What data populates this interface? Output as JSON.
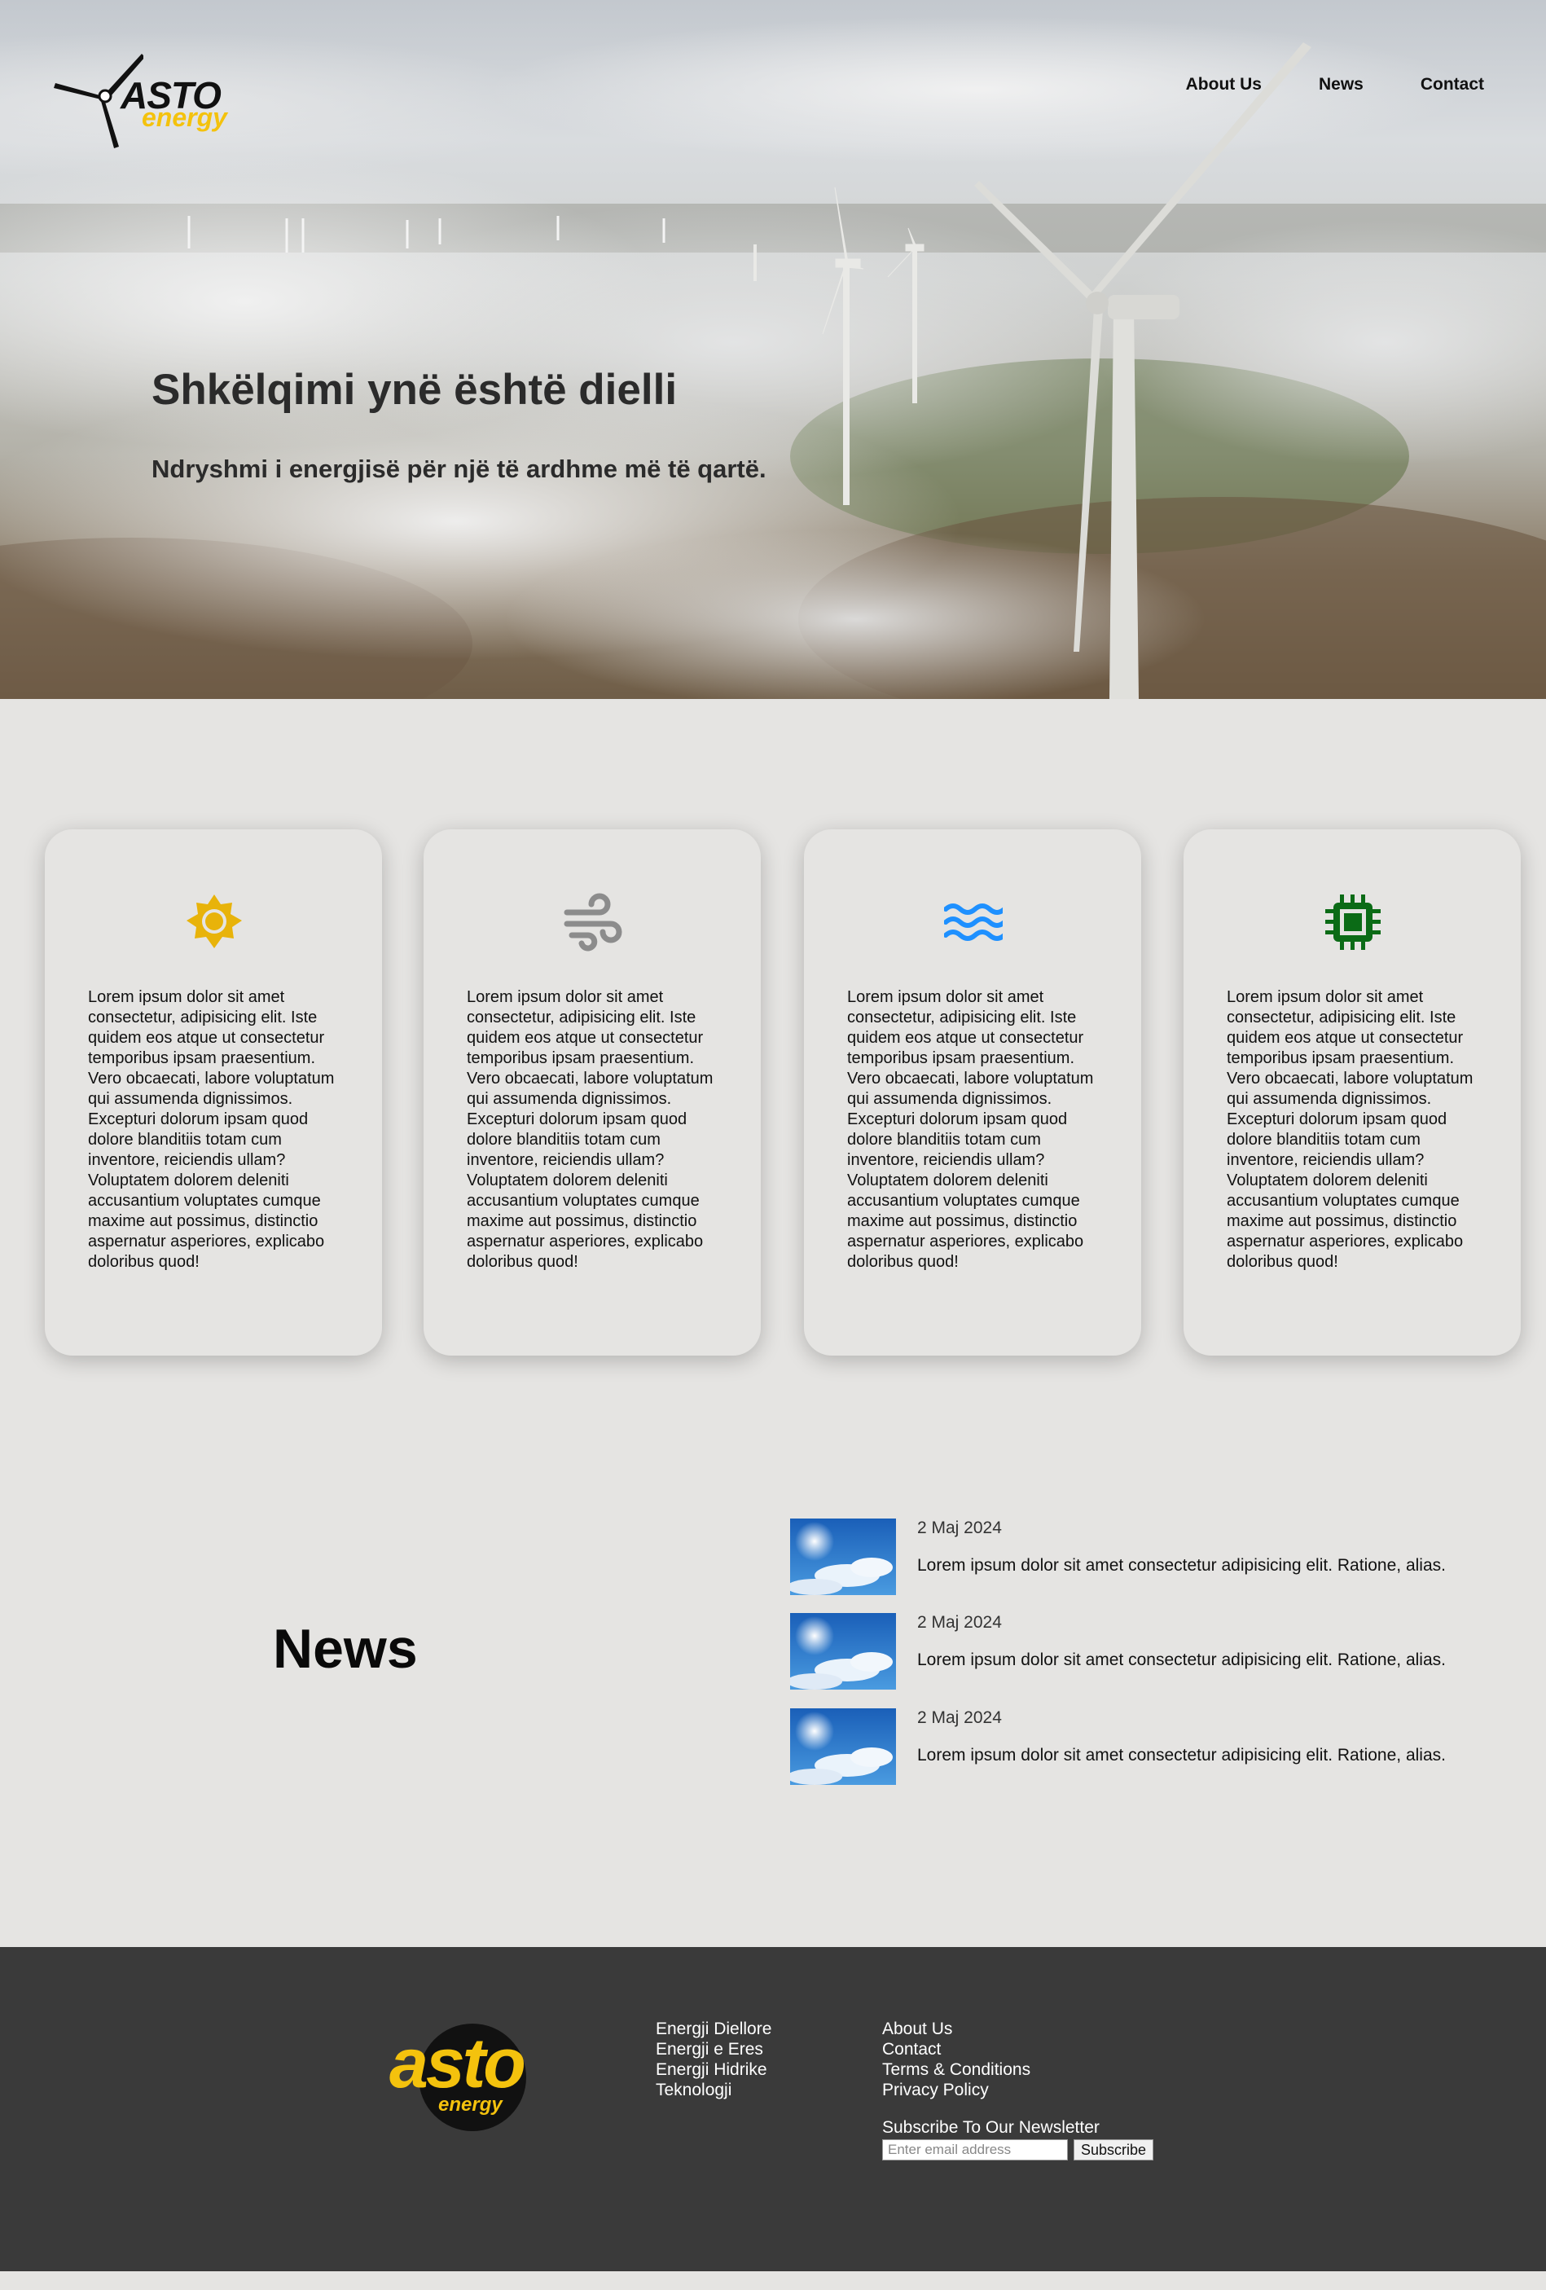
{
  "header": {
    "logo": {
      "word": "ASTO",
      "sub": "energy"
    },
    "nav": [
      {
        "label": "About Us"
      },
      {
        "label": "News"
      },
      {
        "label": "Contact"
      }
    ]
  },
  "hero": {
    "title": "Shkëlqimi ynë është dielli",
    "subtitle": "Ndryshmi i energjisë për një të ardhme më të qartë."
  },
  "cards": [
    {
      "icon": "sun-icon",
      "color": "#e8b30a",
      "text": "Lorem ipsum dolor sit amet consectetur, adipisicing elit. Iste quidem eos atque ut consectetur temporibus ipsam praesentium. Vero obcaecati, labore voluptatum qui assumenda dignissimos. Excepturi dolorum ipsam quod dolore blanditiis totam cum inventore, reiciendis ullam? Voluptatem dolorem deleniti accusantium voluptates cumque maxime aut possimus, distinctio aspernatur asperiores, explicabo doloribus quod!"
    },
    {
      "icon": "wind-icon",
      "color": "#8c8c8c",
      "text": "Lorem ipsum dolor sit amet consectetur, adipisicing elit. Iste quidem eos atque ut consectetur temporibus ipsam praesentium. Vero obcaecati, labore voluptatum qui assumenda dignissimos. Excepturi dolorum ipsam quod dolore blanditiis totam cum inventore, reiciendis ullam? Voluptatem dolorem deleniti accusantium voluptates cumque maxime aut possimus, distinctio aspernatur asperiores, explicabo doloribus quod!"
    },
    {
      "icon": "water-icon",
      "color": "#1e90ff",
      "text": "Lorem ipsum dolor sit amet consectetur, adipisicing elit. Iste quidem eos atque ut consectetur temporibus ipsam praesentium. Vero obcaecati, labore voluptatum qui assumenda dignissimos. Excepturi dolorum ipsam quod dolore blanditiis totam cum inventore, reiciendis ullam? Voluptatem dolorem deleniti accusantium voluptates cumque maxime aut possimus, distinctio aspernatur asperiores, explicabo doloribus quod!"
    },
    {
      "icon": "chip-icon",
      "color": "#0b6b16",
      "text": "Lorem ipsum dolor sit amet consectetur, adipisicing elit. Iste quidem eos atque ut consectetur temporibus ipsam praesentium. Vero obcaecati, labore voluptatum qui assumenda dignissimos. Excepturi dolorum ipsam quod dolore blanditiis totam cum inventore, reiciendis ullam? Voluptatem dolorem deleniti accusantium voluptates cumque maxime aut possimus, distinctio aspernatur asperiores, explicabo doloribus quod!"
    }
  ],
  "news": {
    "heading": "News",
    "items": [
      {
        "date": "2 Maj 2024",
        "text": "Lorem ipsum dolor sit amet consectetur adipisicing elit. Ratione, alias."
      },
      {
        "date": "2 Maj 2024",
        "text": "Lorem ipsum dolor sit amet consectetur adipisicing elit. Ratione, alias."
      },
      {
        "date": "2 Maj 2024",
        "text": "Lorem ipsum dolor sit amet consectetur adipisicing elit. Ratione, alias."
      }
    ]
  },
  "footer": {
    "logo": {
      "word": "asto",
      "sub": "energy"
    },
    "energy_links": [
      "Energji Diellore",
      "Energji e Eres",
      "Energji Hidrike",
      "Teknologji"
    ],
    "info_links": [
      "About Us",
      "Contact",
      "Terms & Conditions",
      "Privacy Policy"
    ],
    "newsletter": {
      "label": "Subscribe To Our Newsletter",
      "placeholder": "Enter email address",
      "button": "Subscribe"
    }
  },
  "colors": {
    "page_bg": "#e5e4e2",
    "footer_bg": "#3a3a3a",
    "brand_yellow": "#f4c20d"
  }
}
